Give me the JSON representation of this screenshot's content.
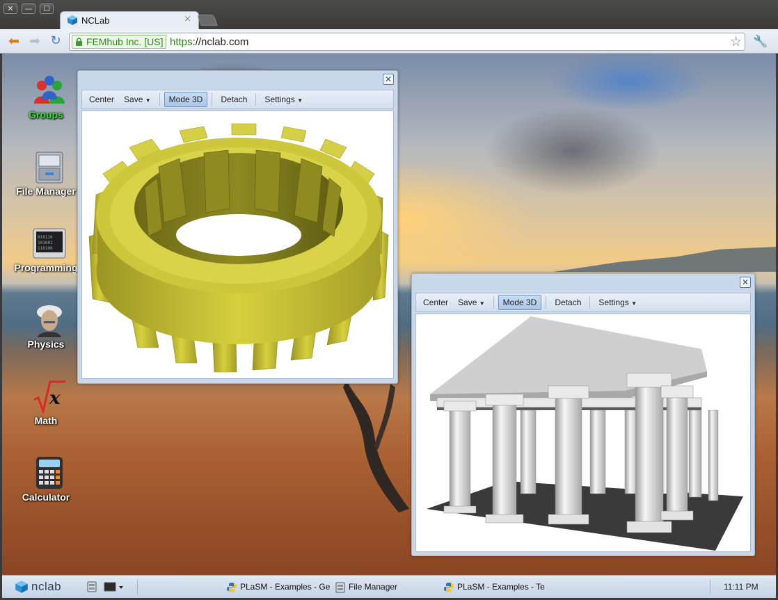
{
  "browser": {
    "tab_title": "NCLab",
    "ev_label": "FEMhub Inc. [US]",
    "url_scheme": "https",
    "url_rest": "://nclab.com",
    "window_buttons": [
      "✕",
      "—",
      "☐"
    ],
    "tab_close": "×"
  },
  "desktop": {
    "icons": [
      {
        "label": "Groups",
        "icon": "groups-icon"
      },
      {
        "label": "File Manager",
        "icon": "file-manager-icon"
      },
      {
        "label": "Programming",
        "icon": "programming-icon"
      },
      {
        "label": "Physics",
        "icon": "physics-icon"
      },
      {
        "label": "Math",
        "icon": "math-icon"
      },
      {
        "label": "Calculator",
        "icon": "calculator-icon"
      }
    ]
  },
  "plot_windows": [
    {
      "close": "✕",
      "toolbar": {
        "center": "Center",
        "save": "Save",
        "mode3d": "Mode 3D",
        "detach": "Detach",
        "settings": "Settings"
      },
      "content": "gear-3d-model"
    },
    {
      "close": "✕",
      "toolbar": {
        "center": "Center",
        "save": "Save",
        "mode3d": "Mode 3D",
        "detach": "Detach",
        "settings": "Settings"
      },
      "content": "temple-3d-model"
    }
  ],
  "taskbar": {
    "logo": "nclab",
    "tasks": [
      {
        "label": "PLaSM - Examples - Ge",
        "icon": "python-icon"
      },
      {
        "label": "File Manager",
        "icon": "file-manager-icon"
      },
      {
        "label": "PLaSM - Examples - Te",
        "icon": "python-icon"
      }
    ],
    "clock": "11:11 PM"
  },
  "colors": {
    "ev_green": "#2c8a1c",
    "window_frame": "#c9d8ea",
    "gear_yellow": "#c9c43a",
    "taskbar": "#d3dfee"
  }
}
